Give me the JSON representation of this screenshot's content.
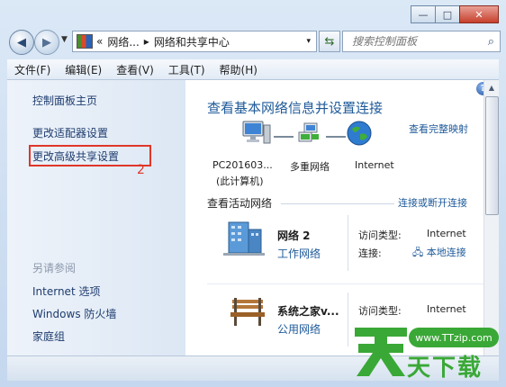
{
  "window": {
    "minimize": "—",
    "maximize": "□",
    "close": "✕"
  },
  "address": {
    "chevrons": "«",
    "crumb1": "网络...",
    "sep": "▸",
    "crumb2": "网络和共享中心",
    "dropdown": "▾"
  },
  "search": {
    "placeholder": "搜索控制面板"
  },
  "menu": [
    "文件(F)",
    "编辑(E)",
    "查看(V)",
    "工具(T)",
    "帮助(H)"
  ],
  "sidebar": {
    "home": "控制面板主页",
    "adapter": "更改适配器设置",
    "advanced": "更改高级共享设置",
    "step": "2",
    "see_also": "另请参阅",
    "links": [
      "Internet 选项",
      "Windows 防火墙",
      "家庭组"
    ]
  },
  "main": {
    "help": "?",
    "title": "查看基本网络信息并设置连接",
    "full_map": "查看完整映射",
    "nodes": {
      "pc_name": "PC201603...",
      "pc_sub": "(此计算机)",
      "multi": "多重网络",
      "internet": "Internet"
    },
    "active_section": "查看活动网络",
    "connect_link": "连接或断开连接",
    "networks": [
      {
        "name": "网络  2",
        "type": "工作网络",
        "access_label": "访问类型:",
        "access_value": "Internet",
        "conn_label": "连接:",
        "conn_value": "本地连接"
      },
      {
        "name": "系统之家v...",
        "type": "公用网络",
        "access_label": "访问类型:",
        "access_value": "Internet"
      }
    ]
  },
  "watermark": {
    "url": "www.TTzip.com",
    "text": "天下载",
    "logo_char": "天"
  },
  "colors": {
    "link": "#1e5a99",
    "highlight": "#e0362a",
    "watermark": "#3aa836"
  }
}
